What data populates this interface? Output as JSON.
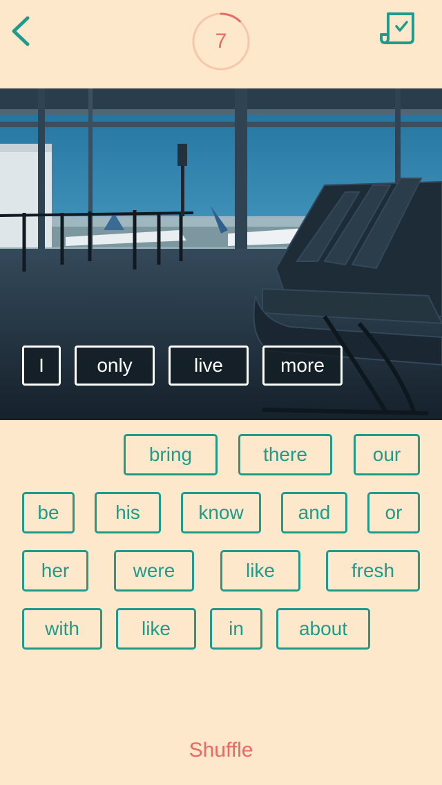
{
  "header": {
    "back_icon": "chevron-left-icon",
    "timer_value": "7",
    "timer_progress": 0.12,
    "submit_icon": "checklist-icon",
    "accent": "#1f9b8c",
    "timer_color": "#e86a62"
  },
  "answer": {
    "words": [
      "I",
      "only",
      "live",
      "more"
    ]
  },
  "word_bank": {
    "row1": [
      "bring",
      "there",
      "our"
    ],
    "row2": [
      "be",
      "his",
      "know",
      "and",
      "or"
    ],
    "row3": [
      "her",
      "were",
      "like",
      "fresh"
    ],
    "row4": [
      "with",
      "like",
      "in",
      "about"
    ]
  },
  "footer": {
    "shuffle_label": "Shuffle"
  }
}
